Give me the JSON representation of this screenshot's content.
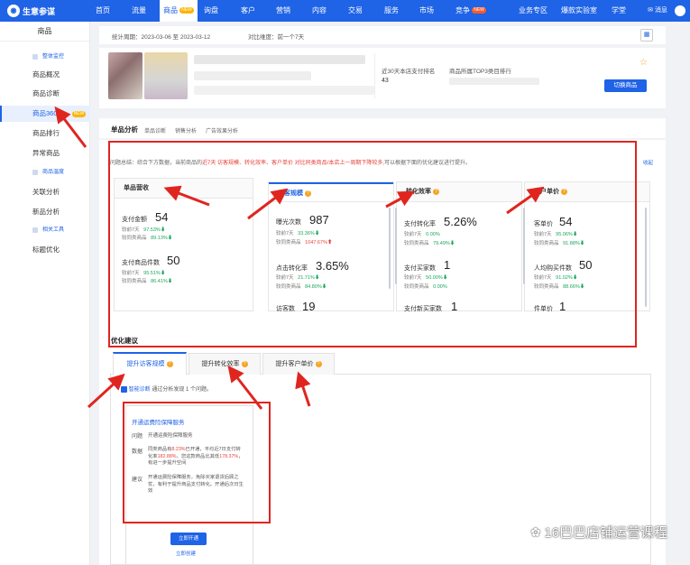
{
  "topnav": {
    "logo": "生意参谋",
    "items": [
      {
        "label": "首页"
      },
      {
        "label": "流量"
      },
      {
        "label": "商品",
        "badge": "NEW"
      },
      {
        "label": "询盘"
      },
      {
        "label": "客户"
      },
      {
        "label": "营销"
      },
      {
        "label": "内容"
      },
      {
        "label": "交易"
      },
      {
        "label": "服务"
      },
      {
        "label": "市场"
      },
      {
        "label": "竞争",
        "badge": "NEW"
      },
      {
        "label": "业务专区"
      },
      {
        "label": "爆款实验室"
      },
      {
        "label": "学堂"
      }
    ],
    "message": "消息"
  },
  "sidebar": {
    "title": "商品",
    "items": [
      {
        "label": "整体监控"
      },
      {
        "label": "商品概况"
      },
      {
        "label": "商品诊断"
      },
      {
        "label": "商品360",
        "badge": "NEW"
      },
      {
        "label": "商品排行"
      },
      {
        "label": "异常商品"
      },
      {
        "label": "商品温度"
      },
      {
        "label": "关联分析"
      },
      {
        "label": "新品分析"
      },
      {
        "label": "相关工具"
      },
      {
        "label": "标题优化"
      }
    ]
  },
  "stats_bar": {
    "period": "统计周期：2023-03-06 至 2023-03-12",
    "compare": "对比维度：前一个7天"
  },
  "product": {
    "rank_label": "近30天本店支付排名",
    "rank_value": "43",
    "category_rank": "商品所属TOP3类目排行",
    "switch_button": "切换商品"
  },
  "single_analysis": {
    "title": "单品分析",
    "tabs": [
      "单品诊断",
      "销售分析",
      "广告效果分析"
    ],
    "summary_prefix": "问题总结：综合下方数据，当前商品的",
    "summary_highlight": "近7天 访客规模、转化效率、客户单价 对比同类商品/本店上一周期下降较多,",
    "summary_suffix": "可以根据下面的优化建议进行提升。",
    "collapse": "收起"
  },
  "cards": {
    "revenue": {
      "title": "单品营收",
      "m1": {
        "label": "支付金额",
        "value": "54",
        "cmp1_label": "较前7天",
        "cmp1": "97.53%",
        "cmp2_label": "较同类商品",
        "cmp2": "89.13%"
      },
      "m2": {
        "label": "支付商品件数",
        "value": "50",
        "cmp1_label": "较前7天",
        "cmp1": "95.51%",
        "cmp2_label": "较同类商品",
        "cmp2": "86.41%"
      }
    },
    "visitors": {
      "title": "访客规模",
      "m1": {
        "label": "曝光次数",
        "value": "987",
        "cmp1_label": "较前7天",
        "cmp1": "33.36%",
        "cmp2_label": "较同类商品",
        "cmp2": "1047.67%"
      },
      "m2": {
        "label": "点击转化率",
        "value": "3.65%",
        "cmp1_label": "较前7天",
        "cmp1": "21.71%",
        "cmp2_label": "较同类商品",
        "cmp2": "84.80%"
      },
      "m3": {
        "label": "访客数",
        "value": "19"
      }
    },
    "conversion": {
      "title": "转化效率",
      "m1": {
        "label": "支付转化率",
        "value": "5.26%",
        "cmp1_label": "较前7天",
        "cmp1": "0.00%",
        "cmp2_label": "较同类商品",
        "cmp2": "79.49%"
      },
      "m2": {
        "label": "支付买家数",
        "value": "1",
        "cmp1_label": "较前7天",
        "cmp1": "50.00%",
        "cmp2_label": "较同类商品",
        "cmp2": "0.00%"
      },
      "m3": {
        "label": "支付新买家数",
        "value": "1"
      }
    },
    "unit_price": {
      "title": "客户单价",
      "m1": {
        "label": "客单价",
        "value": "54",
        "cmp1_label": "较前7天",
        "cmp1": "95.06%",
        "cmp2_label": "较同类商品",
        "cmp2": "91.88%"
      },
      "m2": {
        "label": "人均购买件数",
        "value": "50",
        "cmp1_label": "较前7天",
        "cmp1": "91.02%",
        "cmp2_label": "较同类商品",
        "cmp2": "88.66%"
      },
      "m3": {
        "label": "件单价",
        "value": "1"
      }
    }
  },
  "optimization": {
    "title": "优化建议",
    "tabs": [
      "提升访客规模",
      "提升转化效率",
      "提升客户单价"
    ],
    "diag_label": "智能诊断",
    "diag_text": "通过分析发现 1 个问题。",
    "suggestion": {
      "title": "开通运费险保障服务",
      "problem_label": "问题",
      "problem": "开通运费险保障服务",
      "data_label": "数据",
      "data_prefix": "同类商品有",
      "data_pct1": "8.23%",
      "data_mid1": "已开通，平均近7日支付转化率",
      "data_pct2": "182.88%",
      "data_mid2": "，您这款商品比其低",
      "data_pct3": "178.37%",
      "data_suffix": "，有进一步提升空间",
      "advice_label": "建议",
      "advice": "开通运费险保障服务，免除买家退货后顾之忧，有利于提升商品支付转化。开通后次日生效",
      "button": "立即开通",
      "link": "立即创建"
    }
  },
  "watermark": "16巴巴店铺运营课程"
}
